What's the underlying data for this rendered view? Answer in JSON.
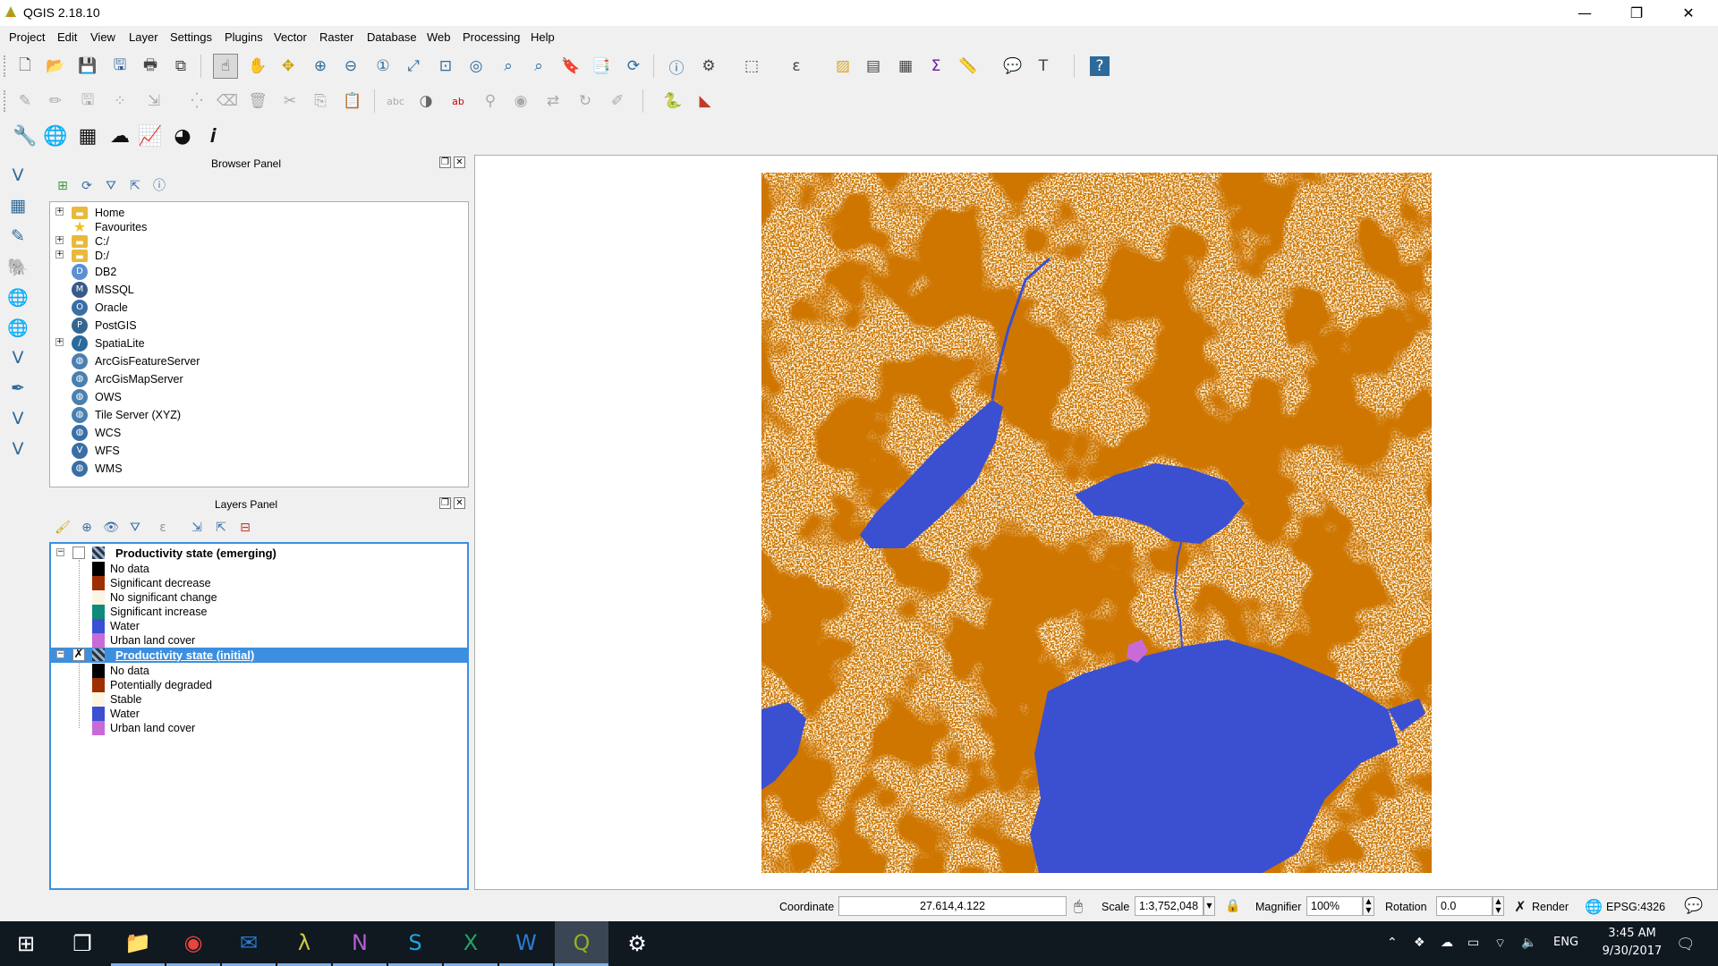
{
  "window": {
    "title": "QGIS 2.18.10",
    "minimize": "—",
    "restore": "❐",
    "close": "✕"
  },
  "menu": [
    "Project",
    "Edit",
    "View",
    "Layer",
    "Settings",
    "Plugins",
    "Vector",
    "Raster",
    "Database",
    "Web",
    "Processing",
    "Help"
  ],
  "browser_panel": {
    "title": "Browser Panel",
    "items": [
      {
        "label": "Home",
        "icon": "folder-icon",
        "expandable": true
      },
      {
        "label": "Favourites",
        "icon": "star-icon",
        "expandable": false
      },
      {
        "label": "C:/",
        "icon": "folder-icon",
        "expandable": true
      },
      {
        "label": "D:/",
        "icon": "folder-icon",
        "expandable": true
      },
      {
        "label": "DB2",
        "icon": "db2-icon",
        "expandable": false
      },
      {
        "label": "MSSQL",
        "icon": "mssql-icon",
        "expandable": false
      },
      {
        "label": "Oracle",
        "icon": "oracle-icon",
        "expandable": false
      },
      {
        "label": "PostGIS",
        "icon": "postgis-icon",
        "expandable": false
      },
      {
        "label": "SpatiaLite",
        "icon": "spatialite-icon",
        "expandable": true
      },
      {
        "label": "ArcGisFeatureServer",
        "icon": "globe-icon",
        "expandable": false
      },
      {
        "label": "ArcGisMapServer",
        "icon": "globe-icon",
        "expandable": false
      },
      {
        "label": "OWS",
        "icon": "globe-icon",
        "expandable": false
      },
      {
        "label": "Tile Server (XYZ)",
        "icon": "globe-icon",
        "expandable": false
      },
      {
        "label": "WCS",
        "icon": "wcs-icon",
        "expandable": false
      },
      {
        "label": "WFS",
        "icon": "wfs-icon",
        "expandable": false
      },
      {
        "label": "WMS",
        "icon": "wms-icon",
        "expandable": false
      }
    ]
  },
  "layers_panel": {
    "title": "Layers Panel",
    "layers": [
      {
        "name": "Productivity state (emerging)",
        "checked": false,
        "selected": false,
        "legend": [
          {
            "label": "No data",
            "color": "#000000"
          },
          {
            "label": "Significant decrease",
            "color": "#9e2f00"
          },
          {
            "label": "No significant change",
            "color": "#fbf6e4"
          },
          {
            "label": "Significant increase",
            "color": "#0e8a7a"
          },
          {
            "label": "Water",
            "color": "#3b4fd1"
          },
          {
            "label": "Urban land cover",
            "color": "#c86bd6"
          }
        ]
      },
      {
        "name": "Productivity state (initial)",
        "checked": true,
        "selected": true,
        "legend": [
          {
            "label": "No data",
            "color": "#000000"
          },
          {
            "label": "Potentially degraded",
            "color": "#9e2f00"
          },
          {
            "label": "Stable",
            "color": "#fbf6e4"
          },
          {
            "label": "Water",
            "color": "#3b4fd1"
          },
          {
            "label": "Urban land cover",
            "color": "#c86bd6"
          }
        ]
      }
    ]
  },
  "status": {
    "coordinate_label": "Coordinate",
    "coordinate_value": "27.614,4.122",
    "scale_label": "Scale",
    "scale_value": "1:3,752,048",
    "magnifier_label": "Magnifier",
    "magnifier_value": "100%",
    "rotation_label": "Rotation",
    "rotation_value": "0.0",
    "render_label": "Render",
    "crs": "EPSG:4326"
  },
  "taskbar": {
    "language": "ENG",
    "time": "3:45 AM",
    "date": "9/30/2017"
  },
  "colors": {
    "degraded": "#9e2f00",
    "stable": "#fbf6e4",
    "water": "#3b4fd1",
    "urban": "#c86bd6",
    "selection": "#3c8fe0"
  }
}
